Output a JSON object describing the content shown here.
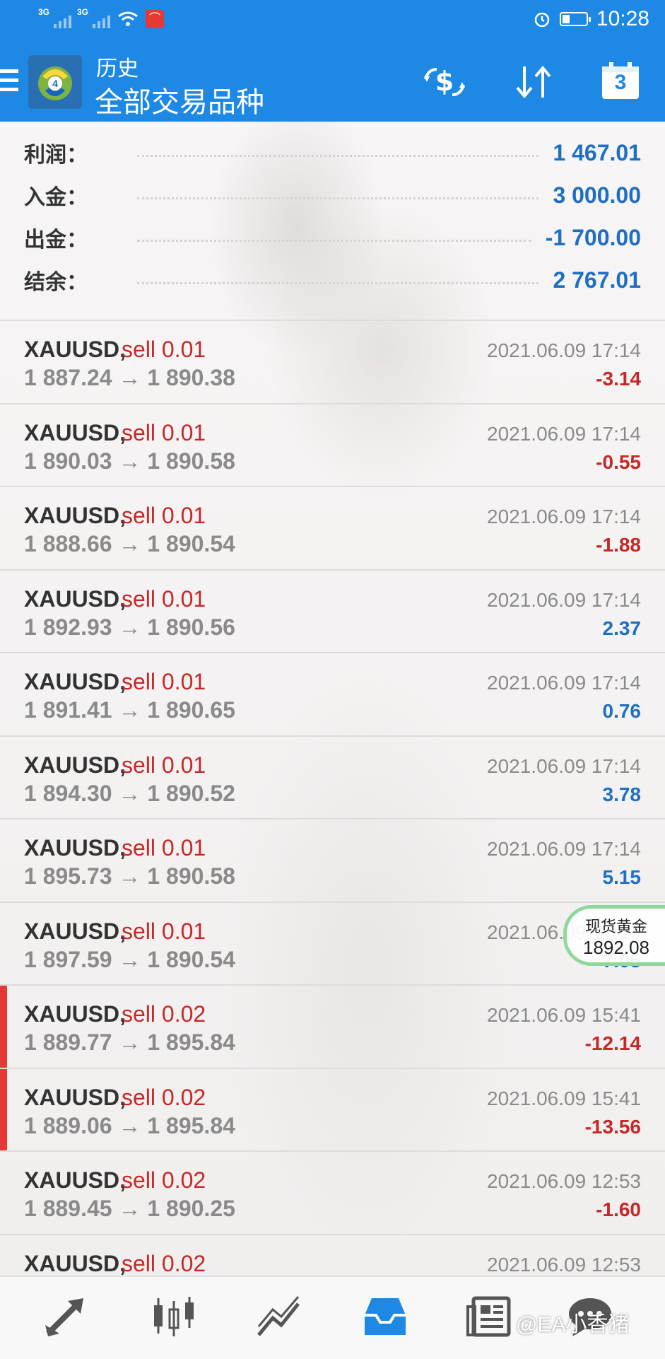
{
  "status_bar": {
    "signal1_label": "3G",
    "signal2_label": "3G",
    "time": "10:28"
  },
  "app_bar": {
    "subtitle": "历史",
    "title": "全部交易品种",
    "icons": [
      "menu-icon",
      "metatrader-logo-icon",
      "balance-operations-icon",
      "sort-icon",
      "calendar-icon"
    ],
    "calendar_badge": "3"
  },
  "summary": {
    "rows": [
      {
        "label": "利润：",
        "value": "1 467.01"
      },
      {
        "label": "入金：",
        "value": "3 000.00"
      },
      {
        "label": "出金：",
        "value": "-1 700.00"
      },
      {
        "label": "结余：",
        "value": "2 767.01"
      }
    ]
  },
  "deals": [
    {
      "symbol": "XAUUSD,",
      "side": "sell 0.01",
      "prices": "1 887.24 → 1 890.38",
      "time": "2021.06.09 17:14",
      "profit": "-3.14",
      "sign": "neg",
      "flag": false
    },
    {
      "symbol": "XAUUSD,",
      "side": "sell 0.01",
      "prices": "1 890.03 → 1 890.58",
      "time": "2021.06.09 17:14",
      "profit": "-0.55",
      "sign": "neg",
      "flag": false
    },
    {
      "symbol": "XAUUSD,",
      "side": "sell 0.01",
      "prices": "1 888.66 → 1 890.54",
      "time": "2021.06.09 17:14",
      "profit": "-1.88",
      "sign": "neg",
      "flag": false
    },
    {
      "symbol": "XAUUSD,",
      "side": "sell 0.01",
      "prices": "1 892.93 → 1 890.56",
      "time": "2021.06.09 17:14",
      "profit": "2.37",
      "sign": "pos",
      "flag": false
    },
    {
      "symbol": "XAUUSD,",
      "side": "sell 0.01",
      "prices": "1 891.41 → 1 890.65",
      "time": "2021.06.09 17:14",
      "profit": "0.76",
      "sign": "pos",
      "flag": false
    },
    {
      "symbol": "XAUUSD,",
      "side": "sell 0.01",
      "prices": "1 894.30 → 1 890.52",
      "time": "2021.06.09 17:14",
      "profit": "3.78",
      "sign": "pos",
      "flag": false
    },
    {
      "symbol": "XAUUSD,",
      "side": "sell 0.01",
      "prices": "1 895.73 → 1 890.58",
      "time": "2021.06.09 17:14",
      "profit": "5.15",
      "sign": "pos",
      "flag": false
    },
    {
      "symbol": "XAUUSD,",
      "side": "sell 0.01",
      "prices": "1 897.59 → 1 890.54",
      "time": "2021.06.09 17:14",
      "profit": "7.05",
      "sign": "pos",
      "flag": false
    },
    {
      "symbol": "XAUUSD,",
      "side": "sell 0.02",
      "prices": "1 889.77 → 1 895.84",
      "time": "2021.06.09 15:41",
      "profit": "-12.14",
      "sign": "neg",
      "flag": true
    },
    {
      "symbol": "XAUUSD,",
      "side": "sell 0.02",
      "prices": "1 889.06 → 1 895.84",
      "time": "2021.06.09 15:41",
      "profit": "-13.56",
      "sign": "neg",
      "flag": true
    },
    {
      "symbol": "XAUUSD,",
      "side": "sell 0.02",
      "prices": "1 889.45 → 1 890.25",
      "time": "2021.06.09 12:53",
      "profit": "-1.60",
      "sign": "neg",
      "flag": false
    },
    {
      "symbol": "XAUUSD,",
      "side": "sell 0.02",
      "prices": "",
      "time": "2021.06.09 12:53",
      "profit": "",
      "sign": "neg",
      "flag": false
    }
  ],
  "gold_widget": {
    "name": "现货黄金",
    "price": "1892.08"
  },
  "bottom_nav": {
    "items": [
      "quotes-icon",
      "chart-icon",
      "trade-icon",
      "history-icon",
      "news-icon",
      "chat-icon"
    ],
    "active": "history-icon"
  },
  "watermark": "@EA小香猪",
  "colors": {
    "accent": "#1e88e5",
    "negative": "#c62828",
    "positive": "#1e6fc4"
  }
}
